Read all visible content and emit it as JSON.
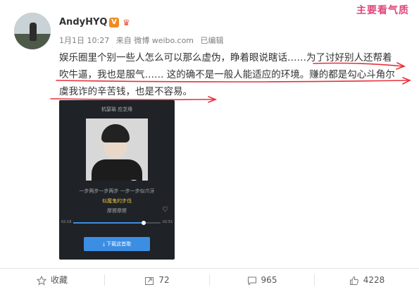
{
  "user": {
    "name": "AndyHYQ",
    "verified_badge": "V"
  },
  "meta": {
    "date": "1月1日 10:27",
    "source": "来自 微博 weibo.com",
    "edited": "已编辑"
  },
  "watermark": "主要看气质",
  "post": {
    "line1": "娱乐圈里个别一些人怎么可以那么虚伪，睁着眼说瞎话……为了讨好别人还帮着",
    "line2": "吹牛逼，我也是服气…… 这的确不是一般人能适应的环境。赚的都是勾心斗角尔",
    "line3": "虞我诈的辛苦钱，也是不容易。"
  },
  "player": {
    "artist": "杭瑟瑜 应芝缘",
    "lyric_prev": "一步两步一步两步 一步一步似爪牙",
    "lyric_current": "似魔鬼的步伐",
    "lyric_next": "摩擦摩擦",
    "time_elapsed": "02:18",
    "time_total": "02:51",
    "progress": 0.81,
    "download_label": "下载这首歌",
    "accent": "#3c8ee3"
  },
  "actions": {
    "favorite": "收藏",
    "repost_count": "72",
    "comment_count": "965",
    "like_count": "4228"
  },
  "colors": {
    "annotation": "#e8303b",
    "watermark": "#e0457a"
  }
}
